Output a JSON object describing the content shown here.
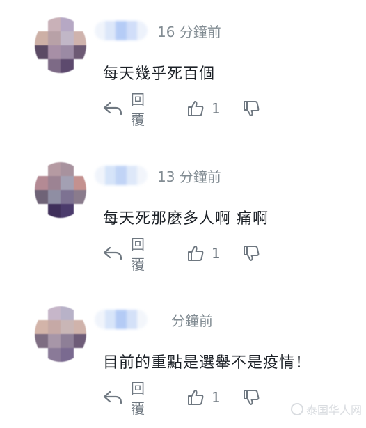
{
  "comments": [
    {
      "time": "16 分鐘前",
      "text": "每天幾乎死百個",
      "reply_label": "回覆",
      "like_count": "1",
      "avatar_colors": [
        "#ffffff",
        "#c9b1b8",
        "#b6a8c4",
        "#ffffff",
        "#cdb0a6",
        "#b8a1a7",
        "#c1b7c7",
        "#cfb3ad",
        "#5b4a64",
        "#a78fa6",
        "#9b8aa4",
        "#6d5a74",
        "#ffffff",
        "#7d6a86",
        "#5d4a6e",
        "#ffffff"
      ],
      "name_colors": [
        "#eef3fb",
        "#d7e3f9",
        "#a9c4f5",
        "#c9d9f8",
        "#eaf0fb"
      ]
    },
    {
      "time": "13 分鐘前",
      "text": "每天死那麼多人啊 痛啊",
      "reply_label": "回覆",
      "like_count": "1",
      "avatar_colors": [
        "#ffffff",
        "#b59aa2",
        "#a8929e",
        "#ffffff",
        "#b48a94",
        "#9c8393",
        "#a3a0b3",
        "#c4918f",
        "#6f6377",
        "#8f8ea3",
        "#7d7292",
        "#8a7b8c",
        "#ffffff",
        "#3f2f5a",
        "#4b3b6c",
        "#ffffff"
      ],
      "name_colors": [
        "#eef3fb",
        "#cfe0f8",
        "#b7cdf5",
        "#d9e5f9",
        "#f0f4fb"
      ]
    },
    {
      "time": "分鐘前",
      "text": "目前的重點是選舉不是疫情！",
      "reply_label": "回覆",
      "like_count": "1",
      "avatar_colors": [
        "#ffffff",
        "#c6b6c9",
        "#b8b2c8",
        "#ffffff",
        "#d3b4a9",
        "#c6a9a6",
        "#c9b6b6",
        "#d0b3ab",
        "#7e6d82",
        "#a796a8",
        "#8e7f97",
        "#6e5c78",
        "#ffffff",
        "#8a7a98",
        "#7a6a90",
        "#ffffff"
      ],
      "name_colors": [
        "#eef3fb",
        "#d2e1f9",
        "#a8c3f4",
        "#cddcf7",
        "#f1f5fb"
      ]
    }
  ],
  "watermark": "泰国华人网"
}
